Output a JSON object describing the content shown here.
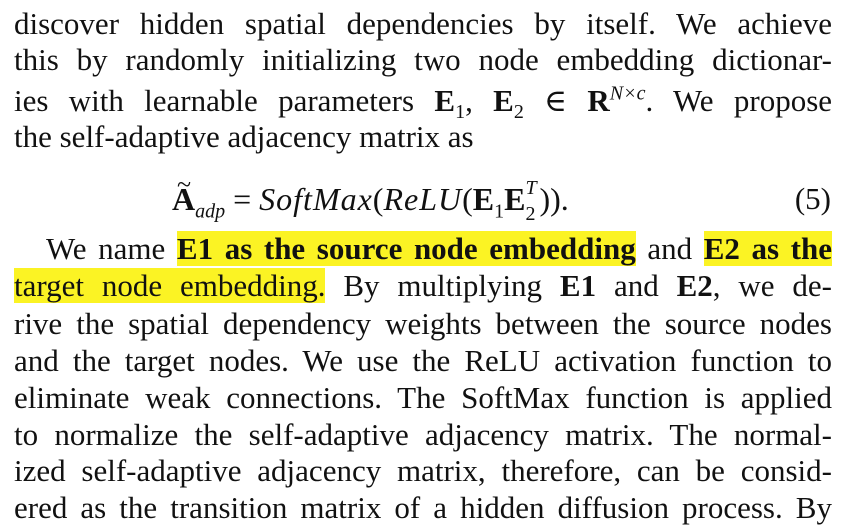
{
  "paragraph1": {
    "line1": "discover hidden spatial dependencies by itself. We achieve",
    "line2": "this by randomly initializing two node embedding dictionar-",
    "line3_pre": "ies with learnable parameters ",
    "line3_E1": "E",
    "line3_sub1": "1",
    "line3_comma": ", ",
    "line3_E2": "E",
    "line3_sub2": "2",
    "line3_in": " ∈ ",
    "line3_R": "R",
    "line3_sup": "N×c",
    "line3_post": ". We propose",
    "line4": "the self-adaptive adjacency matrix as"
  },
  "equation": {
    "A": "A",
    "tilde": "~",
    "sub": "adp",
    "equals": " = ",
    "softmax": "SoftMax",
    "open1": "(",
    "relu": "ReLU",
    "open2": "(",
    "E1": "E",
    "E1_sub": "1",
    "E2": "E",
    "E2_sub": "2",
    "E2_sup": "T",
    "close": ")).",
    "number": "(5)"
  },
  "paragraph2": {
    "l1_pre": "We name ",
    "l1_hl1": "E1 as the source node embedding",
    "l1_mid": " and ",
    "l1_hl2": "E2 as the",
    "l2_hl": "target node embedding.",
    "l2_post_a": " By multiplying ",
    "l2_E1": "E1",
    "l2_and": " and ",
    "l2_E2": "E2",
    "l2_post_b": ", we de-",
    "l3": "rive the spatial dependency weights between the source nodes",
    "l4": "and the target nodes. We use the ReLU activation function to",
    "l5": "eliminate weak connections. The SoftMax function is applied",
    "l6": "to normalize the self-adaptive adjacency matrix. The normal-",
    "l7": "ized self-adaptive adjacency matrix, therefore, can be consid-",
    "l8": "ered as the transition matrix of a hidden diffusion process. By"
  }
}
